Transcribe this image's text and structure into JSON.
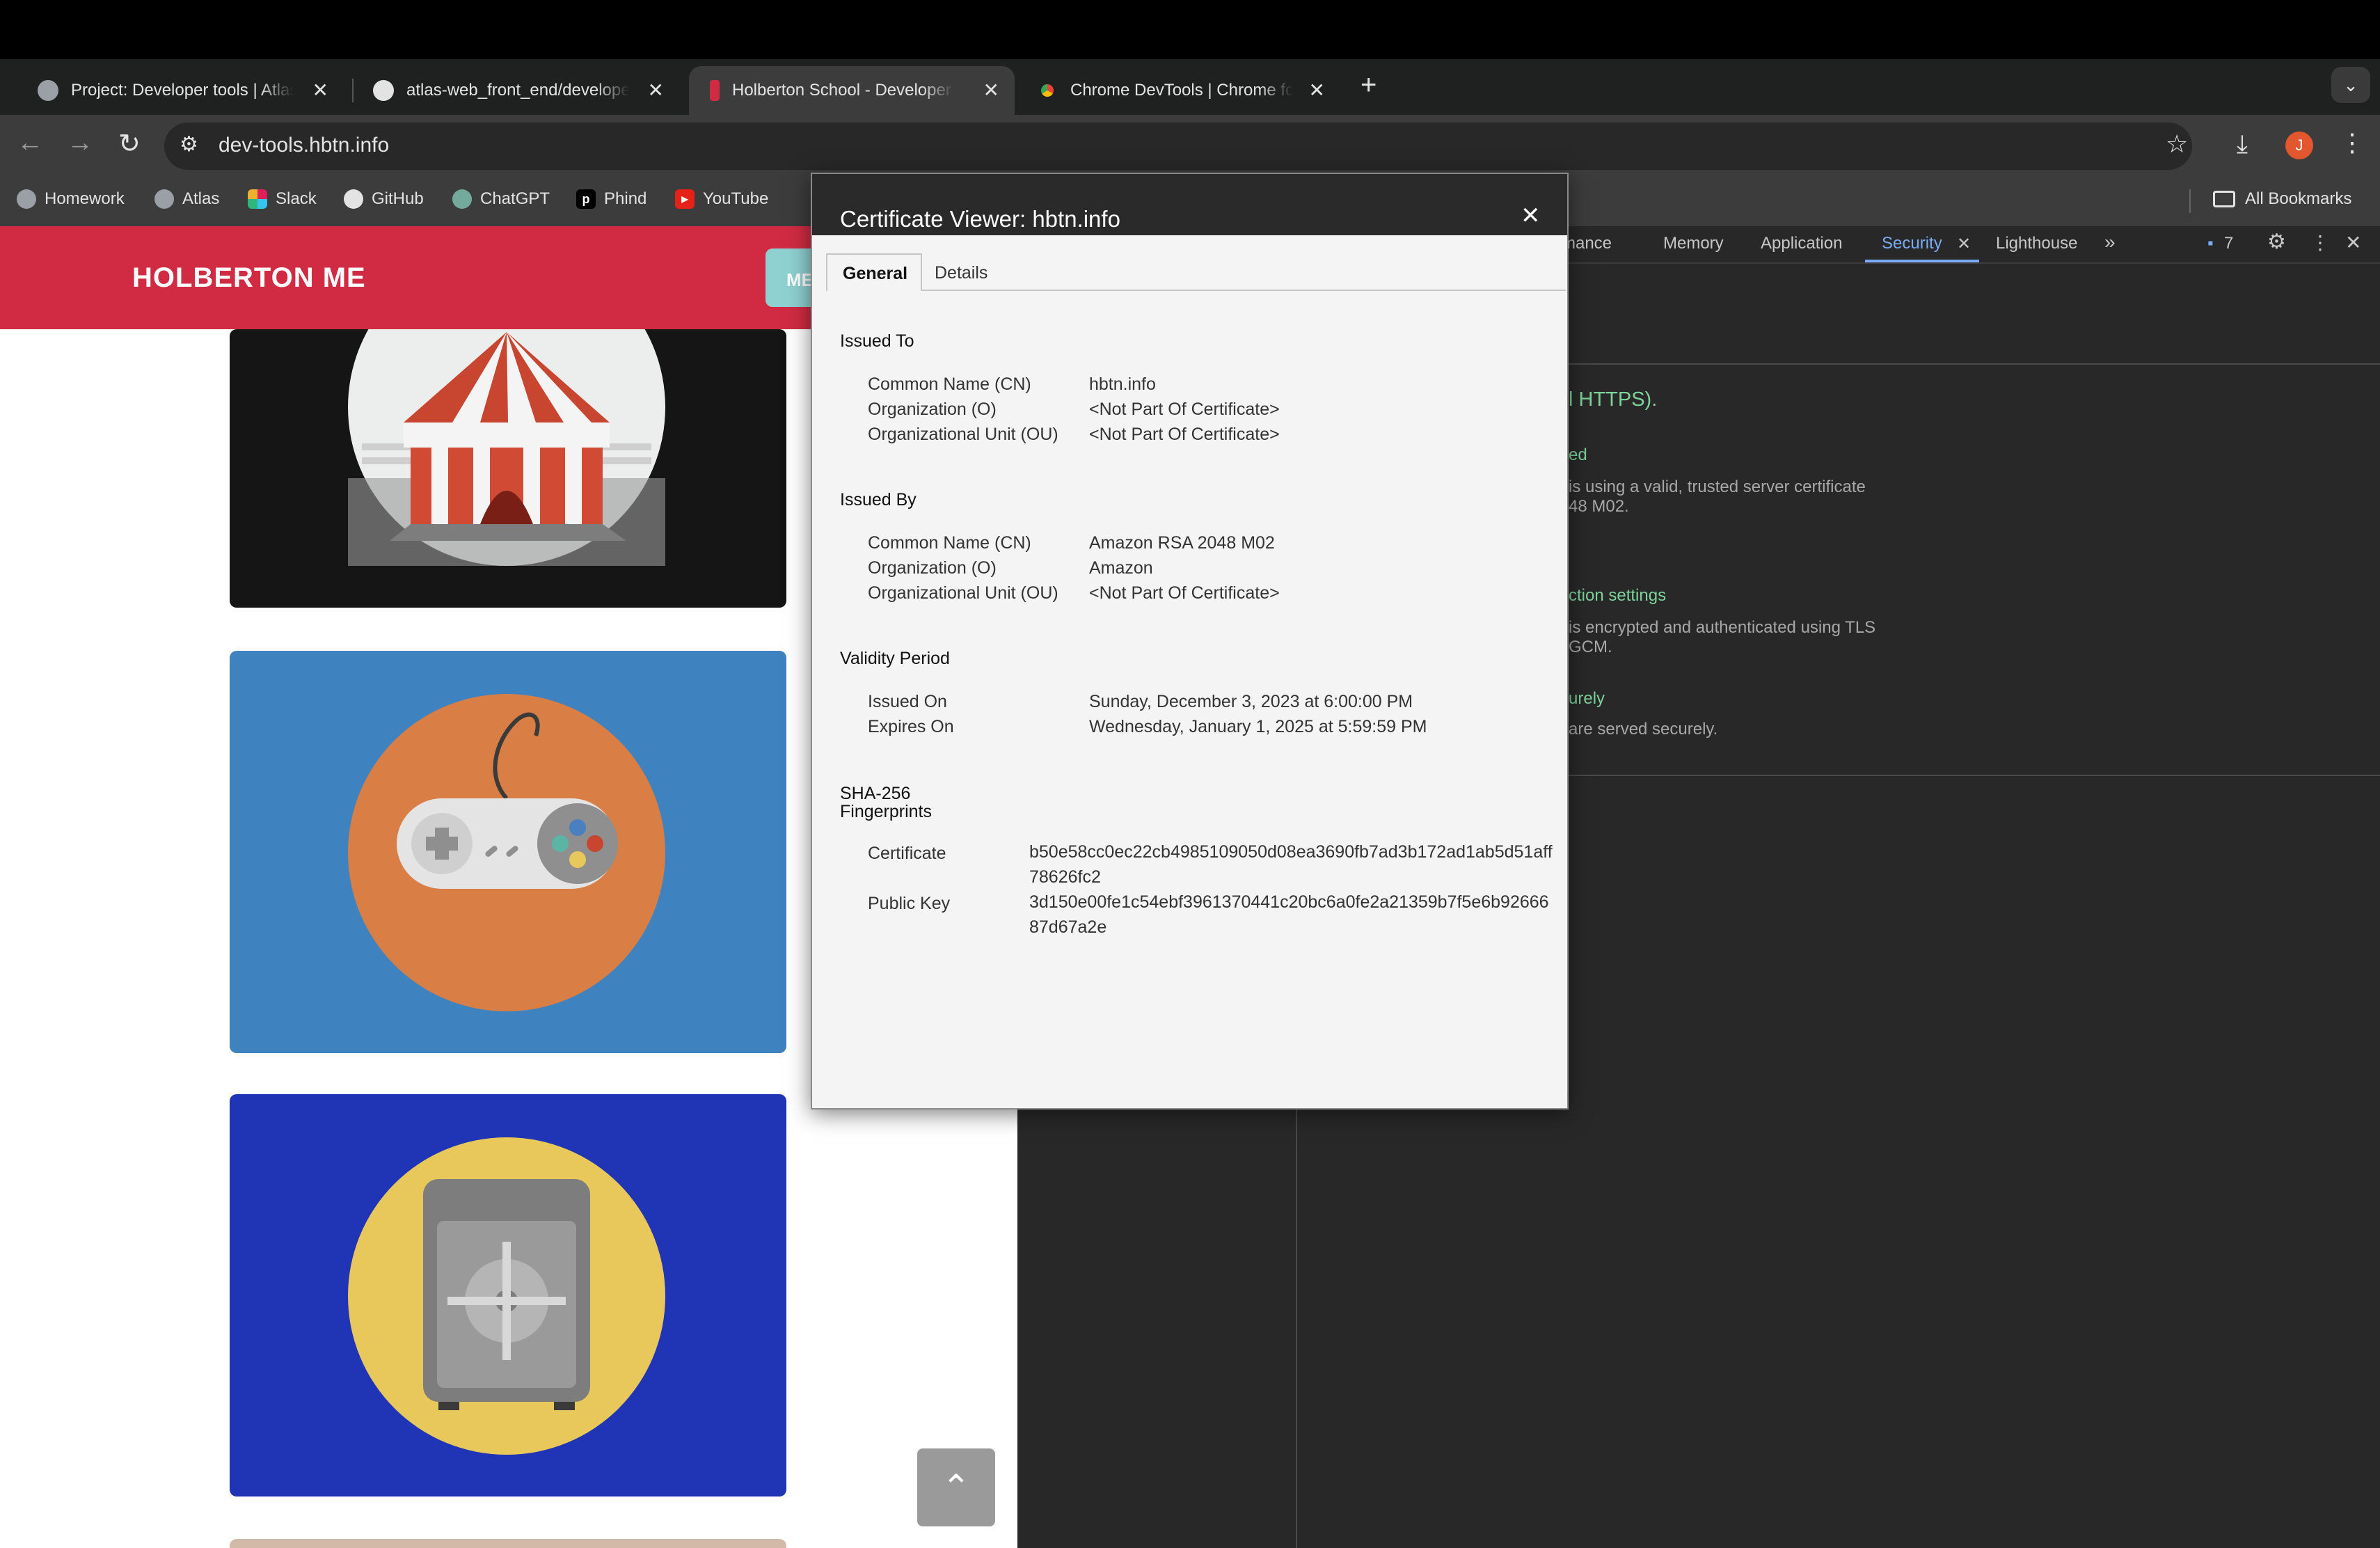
{
  "browser": {
    "tabs": [
      {
        "title": "Project: Developer tools | Atlas",
        "icon": "globe-icon"
      },
      {
        "title": "atlas-web_front_end/developer_tools",
        "icon": "github-icon"
      },
      {
        "title": "Holberton School - Developer tools",
        "icon": "holberton-icon"
      },
      {
        "title": "Chrome DevTools | Chrome for Developers",
        "icon": "chrome-icon"
      }
    ],
    "new_tab": "+",
    "tab_menu": "⌄",
    "url": "dev-tools.hbtn.info",
    "avatar_letter": "J"
  },
  "bookmarks": {
    "items": [
      {
        "label": "Homework",
        "icon": "globe-icon"
      },
      {
        "label": "Atlas",
        "icon": "globe-icon"
      },
      {
        "label": "Slack",
        "icon": "slack-icon"
      },
      {
        "label": "GitHub",
        "icon": "github-icon"
      },
      {
        "label": "ChatGPT",
        "icon": "chatgpt-icon"
      },
      {
        "label": "Phind",
        "icon": "phind-icon"
      },
      {
        "label": "YouTube",
        "icon": "youtube-icon"
      }
    ],
    "all_bookmarks": "All Bookmarks"
  },
  "page": {
    "brand": "HOLBERTON ME",
    "menu_label": "ME",
    "colors": {
      "header": "#d02b43",
      "card_gamepad": "#3f82c0",
      "card_safe": "#1f35b5",
      "circle_orange": "#d97e45",
      "circle_yellow": "#e8c85a"
    }
  },
  "devtools": {
    "tabs": [
      "rmance",
      "Memory",
      "Application",
      "Security",
      "Lighthouse"
    ],
    "active_tab": "Security",
    "issues_count": "7",
    "security": {
      "summary_tail": "l HTTPS).",
      "cert_heading_tail": "ed",
      "cert_line1": "is using a valid, trusted server certificate",
      "cert_line2": "48 M02.",
      "conn_heading_tail": "ction settings",
      "conn_line1": "is encrypted and authenticated using TLS",
      "conn_line2": "GCM.",
      "res_heading_tail": "urely",
      "res_line1": "are served securely."
    }
  },
  "certificate": {
    "title": "Certificate Viewer: hbtn.info",
    "tabs": {
      "general": "General",
      "details": "Details"
    },
    "issued_to": {
      "heading": "Issued To",
      "rows": [
        {
          "label": "Common Name (CN)",
          "value": "hbtn.info"
        },
        {
          "label": "Organization (O)",
          "value": "<Not Part Of Certificate>"
        },
        {
          "label": "Organizational Unit (OU)",
          "value": "<Not Part Of Certificate>"
        }
      ]
    },
    "issued_by": {
      "heading": "Issued By",
      "rows": [
        {
          "label": "Common Name (CN)",
          "value": "Amazon RSA 2048 M02"
        },
        {
          "label": "Organization (O)",
          "value": "Amazon"
        },
        {
          "label": "Organizational Unit (OU)",
          "value": "<Not Part Of Certificate>"
        }
      ]
    },
    "validity": {
      "heading": "Validity Period",
      "rows": [
        {
          "label": "Issued On",
          "value": "Sunday, December 3, 2023 at 6:00:00 PM"
        },
        {
          "label": "Expires On",
          "value": "Wednesday, January 1, 2025 at 5:59:59 PM"
        }
      ]
    },
    "fingerprints": {
      "heading_line1": "SHA-256",
      "heading_line2": "Fingerprints",
      "rows": [
        {
          "label": "Certificate",
          "value": "b50e58cc0ec22cb4985109050d08ea3690fb7ad3b172ad1ab5d51aff78626fc2"
        },
        {
          "label": "Public Key",
          "value": "3d150e00fe1c54ebf3961370441c20bc6a0fe2a21359b7f5e6b9266687d67a2e"
        }
      ]
    }
  }
}
